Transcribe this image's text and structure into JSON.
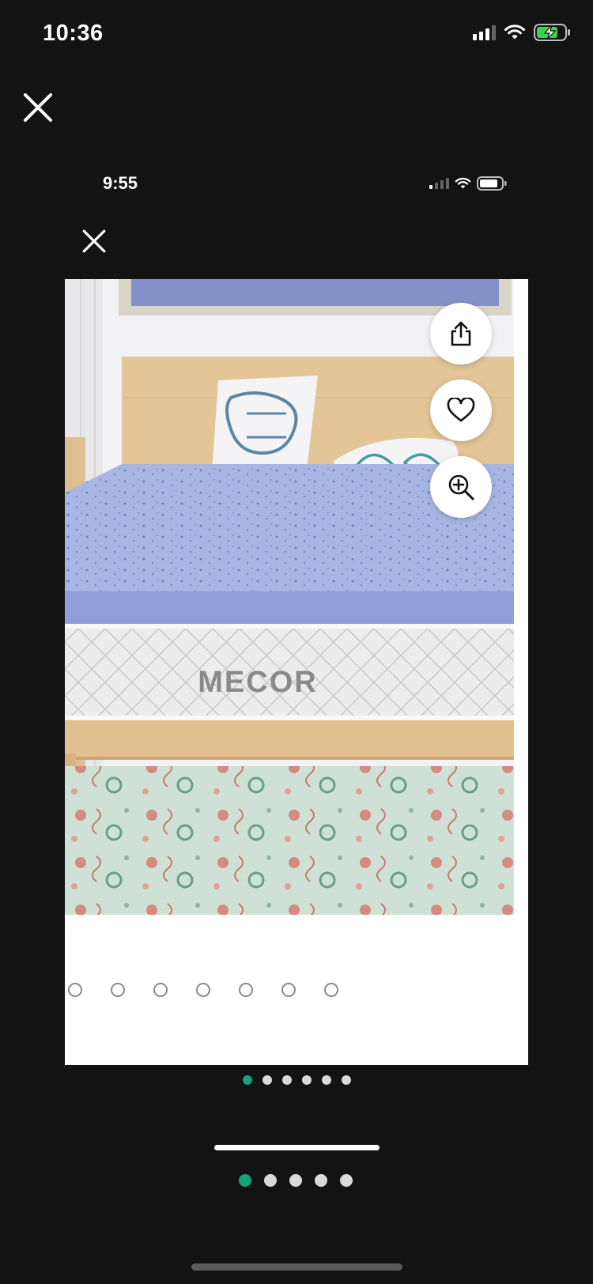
{
  "outer_status": {
    "time": "10:36"
  },
  "inner_status": {
    "time": "9:55"
  },
  "product": {
    "brand_mark": "MECOR",
    "actions": {
      "share": "share-icon",
      "favorite": "heart-icon",
      "zoom": "zoom-in-icon"
    },
    "thumbnail_placeholders": 7
  },
  "inner_carousel": {
    "total": 6,
    "active": 1
  },
  "outer_carousel": {
    "total": 5,
    "active": 1
  },
  "colors": {
    "accent": "#16a37a",
    "background": "#131313",
    "battery_charging": "#3ecf4f"
  }
}
